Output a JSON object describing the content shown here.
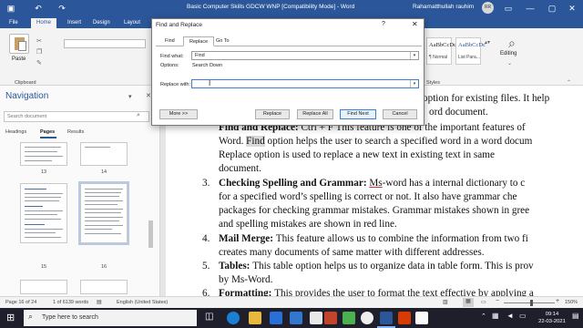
{
  "window": {
    "title": "Basic Computer Skills GDCW WNP [Compatibility Mode] - Word",
    "user": "Rahamatthullah rauhim",
    "avatar_initials": "RR"
  },
  "ribbon": {
    "tabs": [
      "File",
      "Home",
      "Insert",
      "Design",
      "Layout"
    ],
    "paste_label": "Paste",
    "clipboard_label": "Clipboard",
    "styles_label": "Styles",
    "style_samples": [
      "AaBbCcDc",
      "AaBbCcDc"
    ],
    "style_names": [
      "¶ Normal",
      "List Para..."
    ],
    "editing_label": "Editing"
  },
  "navigation": {
    "title": "Navigation",
    "search_placeholder": "Search document",
    "tabs": [
      "Headings",
      "Pages",
      "Results"
    ],
    "active_tab": "Pages",
    "page_numbers": [
      "13",
      "14",
      "15",
      "16"
    ]
  },
  "document": {
    "line0": "option for existing files. It help",
    "line1": "ord document.",
    "line2a": "Find and Replace: ",
    "line2b": "Ctrl + F This feature is one of the important features of",
    "line3a": "Word. ",
    "line3hl": "Find",
    "line3b": " option helps the user to search a specified word in a word docum",
    "line4": "Replace option is used to replace a new text in existing text in same",
    "line5": "document.",
    "item3_num": "3.",
    "item3_head": "Checking Spelling and Grammar: ",
    "item3_ms": "Ms",
    "item3_rest": "-word has a internal dictionary to c",
    "line7": "for a specified word’s spelling is correct or not. It also have grammar che",
    "line8": "packages for checking grammar mistakes. Grammar mistakes shown in gree",
    "line9": "and spelling mistakes are shown in red line.",
    "item4_num": "4.",
    "item4_head": "Mail Merge: ",
    "item4_rest": "This feature allows us to combine the information from two fi",
    "line11": "creates many documents of same matter with different addresses.",
    "item5_num": "5.",
    "item5_head": "Tables: ",
    "item5_rest": "This table option helps us to organize data in table form. This is prov",
    "line13": "by Ms-Word.",
    "item6_num": "6.",
    "item6_head": "Formatting: ",
    "item6_rest": "This provides the user to format the text effective by applying a"
  },
  "dialog": {
    "title": "Find and Replace",
    "help": "?",
    "close": "✕",
    "tabs": [
      "Find",
      "Replace",
      "Go To"
    ],
    "active_tab": "Replace",
    "find_label": "Find what:",
    "find_value": "Find",
    "options_label": "Options:",
    "options_value": "Search Down",
    "replace_label": "Replace with:",
    "replace_value": "",
    "more_button": "More >>",
    "replace_button": "Replace",
    "replace_all_button": "Replace All",
    "find_next_button": "Find Next",
    "cancel_button": "Cancel"
  },
  "status": {
    "page": "Page 16 of 24",
    "words": "1 of 6139 words",
    "language": "English (United States)",
    "zoom": "150%"
  },
  "taskbar": {
    "search_placeholder": "Type here to search",
    "time": "09:14",
    "date": "22-03-2021"
  },
  "colors": {
    "word_blue": "#2b579a",
    "spell_red": "#d03030",
    "taskbar": "#1f1f2b"
  }
}
